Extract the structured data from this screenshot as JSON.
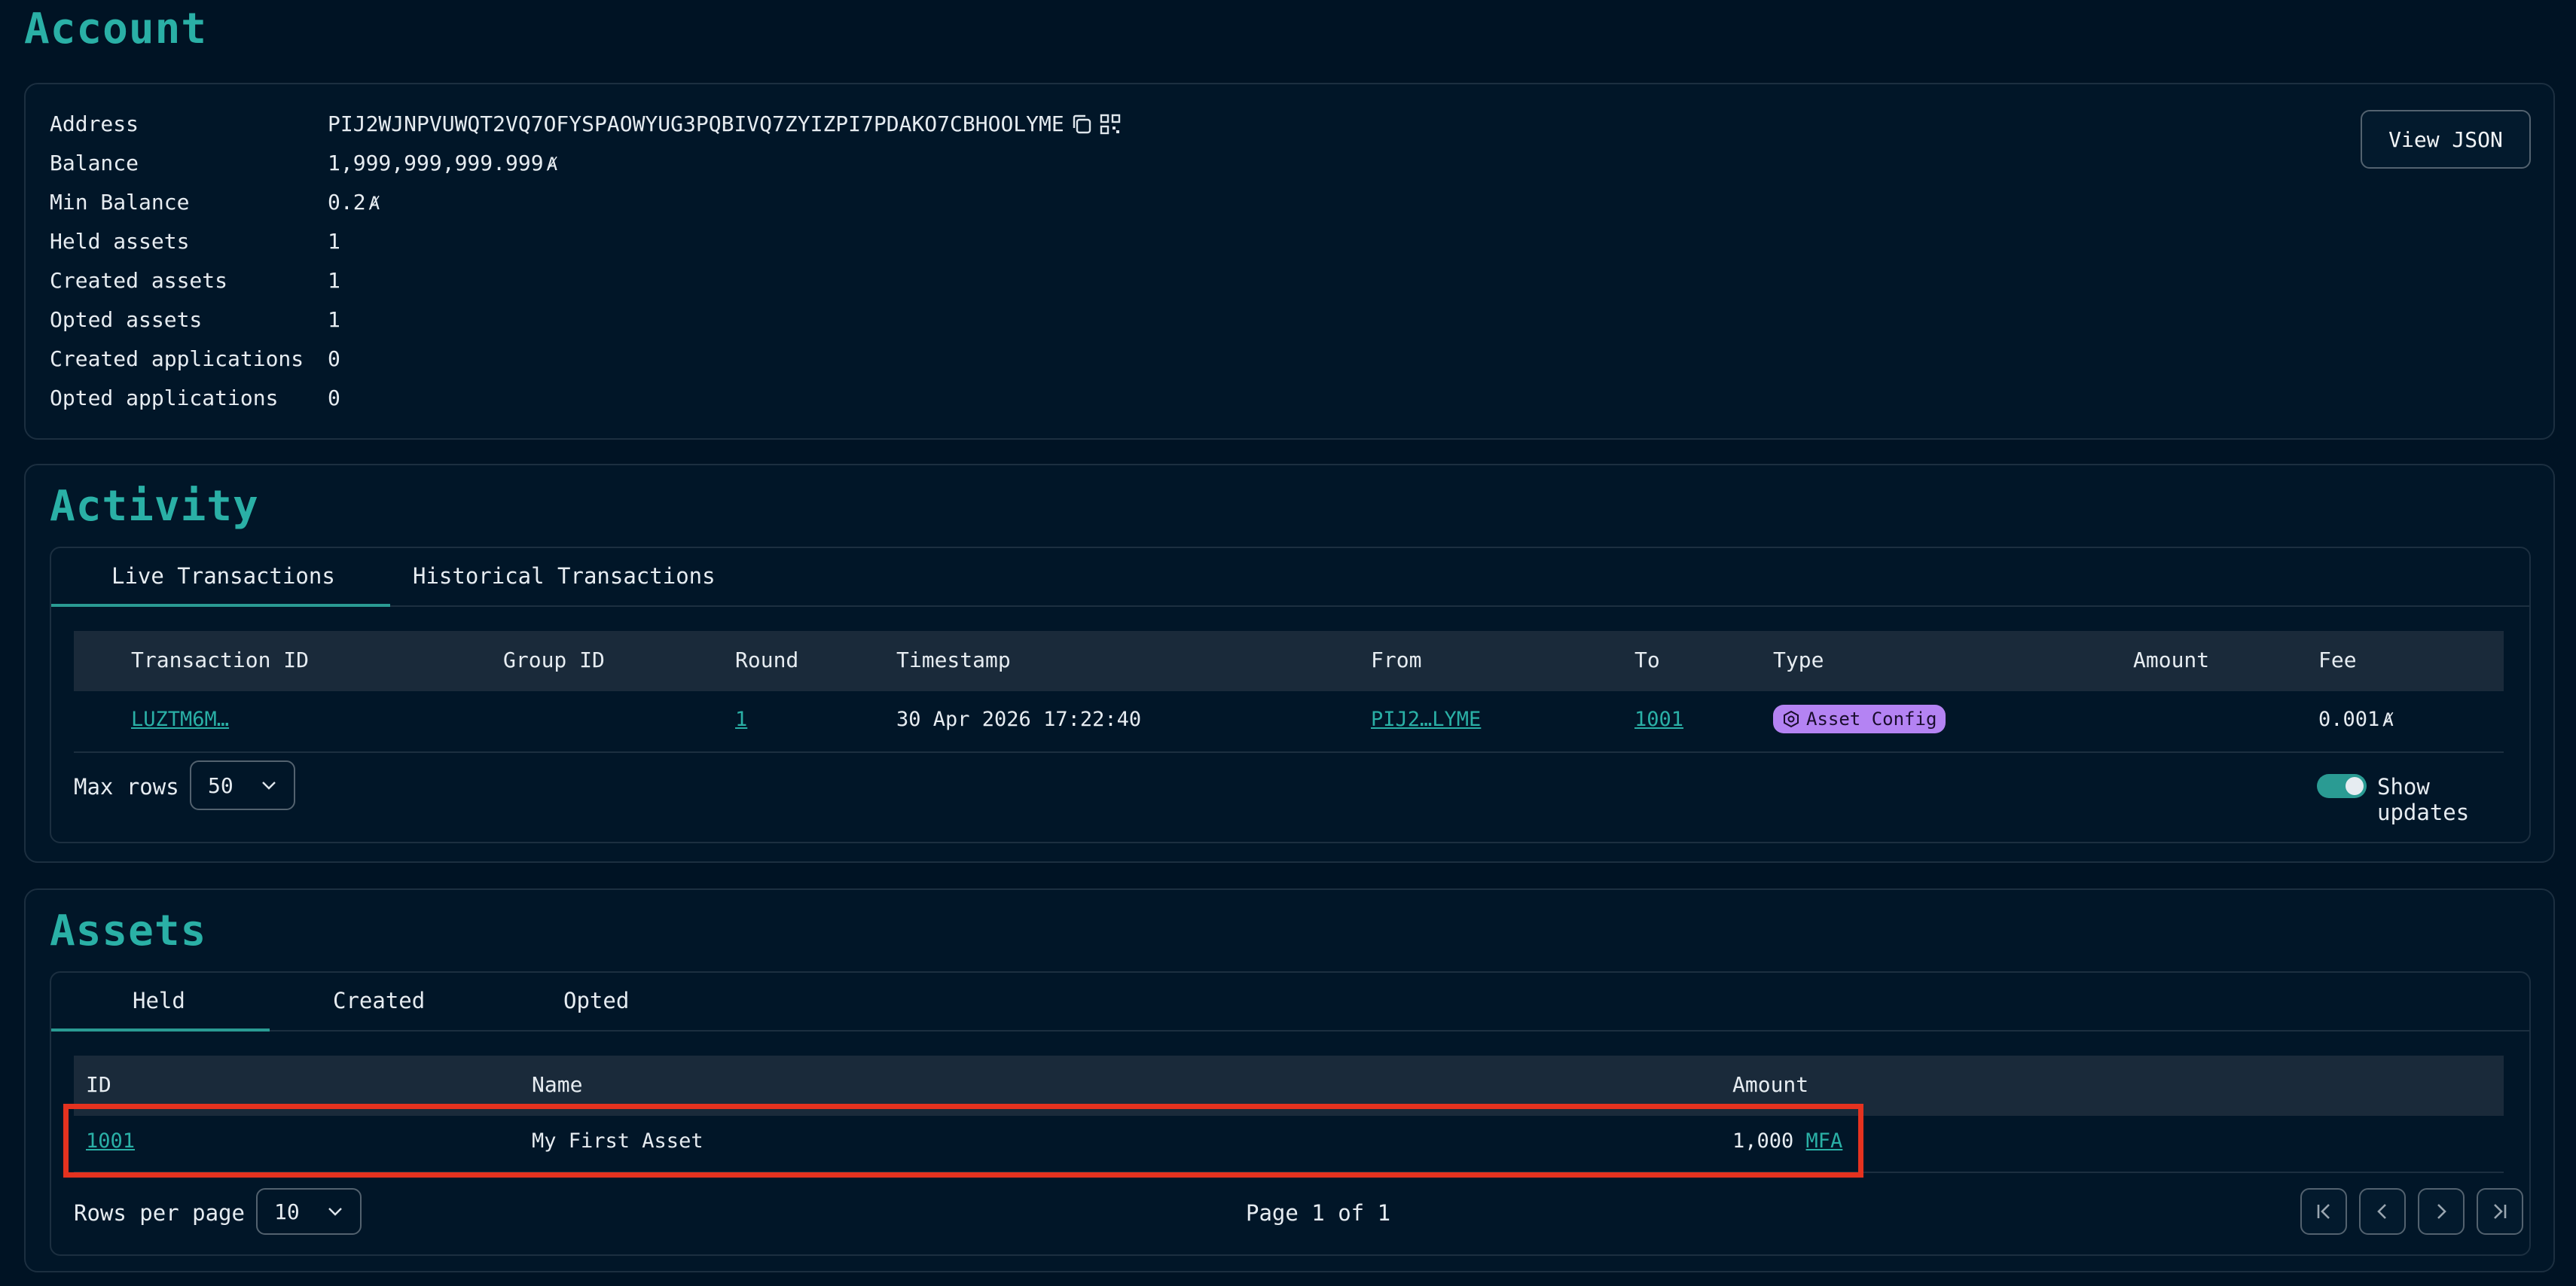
{
  "page": {
    "title": "Account"
  },
  "account": {
    "rows": [
      {
        "label": "Address",
        "value": "PIJ2WJNPVUWQT2VQ7OFYSPAOWYUG3PQBIVQ7ZYIZPI7PDAKO7CBHOOLYME"
      },
      {
        "label": "Balance",
        "value": "1,999,999,999.999"
      },
      {
        "label": "Min Balance",
        "value": "0.2"
      },
      {
        "label": "Held assets",
        "value": "1"
      },
      {
        "label": "Created assets",
        "value": "1"
      },
      {
        "label": "Opted assets",
        "value": "1"
      },
      {
        "label": "Created applications",
        "value": "0"
      },
      {
        "label": "Opted applications",
        "value": "0"
      }
    ],
    "algo_symbol": "Ⱥ",
    "view_json_label": "View JSON"
  },
  "activity": {
    "title": "Activity",
    "tabs": [
      "Live Transactions",
      "Historical Transactions"
    ],
    "columns": [
      "Transaction ID",
      "Group ID",
      "Round",
      "Timestamp",
      "From",
      "To",
      "Type",
      "Amount",
      "Fee"
    ],
    "rows": [
      {
        "transaction_id": "LUZTM6M…",
        "group_id": "",
        "round": "1",
        "timestamp": "30 Apr 2026 17:22:40",
        "from": "PIJ2…LYME",
        "to": "1001",
        "type": "Asset Config",
        "amount": "",
        "fee": "0.001"
      }
    ],
    "max_rows_label": "Max rows",
    "max_rows_value": "50",
    "show_updates_label": "Show updates",
    "show_updates_on": true
  },
  "assets": {
    "title": "Assets",
    "tabs": [
      "Held",
      "Created",
      "Opted"
    ],
    "columns": [
      "ID",
      "Name",
      "Amount"
    ],
    "rows": [
      {
        "id": "1001",
        "name": "My First Asset",
        "amount": "1,000",
        "unit": "MFA"
      }
    ],
    "rows_per_page_label": "Rows per page",
    "rows_per_page_value": "10",
    "page_text": "Page 1 of 1"
  },
  "colors": {
    "background": "#001324",
    "accent": "#2ab0a6",
    "badge": "#b483f3",
    "highlight": "#e5321f"
  }
}
